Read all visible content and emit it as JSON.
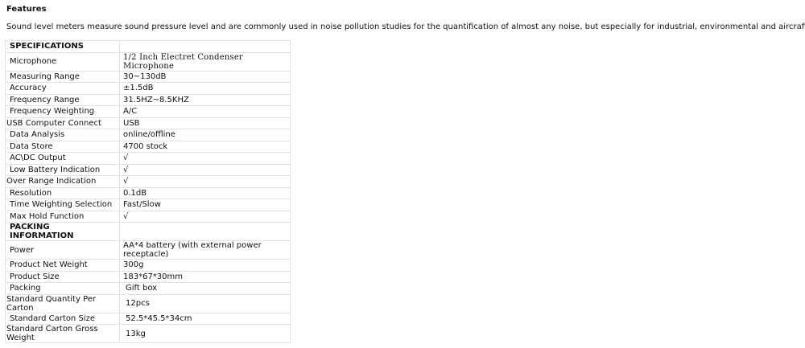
{
  "features": {
    "heading": "Features",
    "description": "Sound level meters measure sound pressure level and are commonly used in noise pollution studies for the quantification of almost any noise, but especially for industrial, environmental and aircraft noise."
  },
  "specifications": {
    "header": "SPECIFICATIONS",
    "rows": [
      {
        "label": "Microphone",
        "value": "1/2 Inch Electret Condenser Microphone"
      },
      {
        "label": "Measuring Range",
        "value": "30~130dB"
      },
      {
        "label": "Accuracy",
        "value": "±1.5dB"
      },
      {
        "label": "Frequency Range",
        "value": "31.5HZ~8.5KHZ"
      },
      {
        "label": "Frequency Weighting",
        "value": "A/C"
      },
      {
        "label": "USB Computer Connect",
        "value": "USB"
      },
      {
        "label": "Data Analysis",
        "value": "online/offline"
      },
      {
        "label": "Data Store",
        "value": "4700 stock"
      },
      {
        "label": "AC\\DC Output",
        "value": "√"
      },
      {
        "label": "Low Battery Indication",
        "value": "√"
      },
      {
        "label": "Over Range Indication",
        "value": "√"
      },
      {
        "label": "Resolution",
        "value": "0.1dB"
      },
      {
        "label": "Time Weighting Selection",
        "value": "Fast/Slow"
      },
      {
        "label": "Max Hold Function",
        "value": "√"
      }
    ]
  },
  "packing": {
    "header": "PACKING INFORMATION",
    "rows": [
      {
        "label": "Power",
        "value": "AA*4 battery (with external power receptacle)"
      },
      {
        "label": "Product Net Weight",
        "value": "300g"
      },
      {
        "label": "Product Size",
        "value": "183*67*30mm"
      },
      {
        "label": "Packing",
        "value": "Gift box"
      },
      {
        "label": "Standard Quantity Per Carton",
        "value": "12pcs"
      },
      {
        "label": "Standard Carton Size",
        "value": "52.5*45.5*34cm"
      },
      {
        "label": "Standard Carton Gross Weight",
        "value": "13kg"
      }
    ]
  }
}
